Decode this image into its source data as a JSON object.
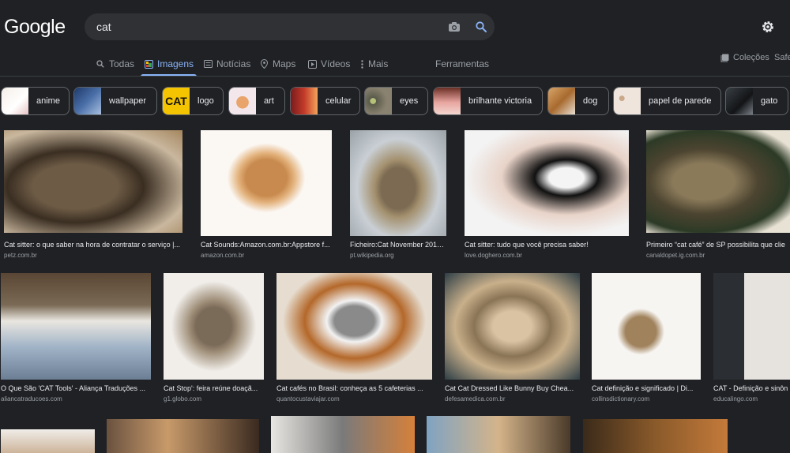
{
  "header": {
    "logo": "Google",
    "query": "cat"
  },
  "tabs": [
    {
      "label": "Todas"
    },
    {
      "label": "Imagens"
    },
    {
      "label": "Notícias"
    },
    {
      "label": "Maps"
    },
    {
      "label": "Vídeos"
    },
    {
      "label": "Mais"
    },
    {
      "label": "Ferramentas"
    },
    {
      "label": "Coleções"
    },
    {
      "label": "Safe"
    }
  ],
  "chips": [
    {
      "label": "anime"
    },
    {
      "label": "wallpaper"
    },
    {
      "label": "logo"
    },
    {
      "label": "art"
    },
    {
      "label": "celular"
    },
    {
      "label": "eyes"
    },
    {
      "label": "brilhante victoria"
    },
    {
      "label": "dog"
    },
    {
      "label": "papel de parede"
    },
    {
      "label": "gato"
    }
  ],
  "results": [
    {
      "caption": "Cat sitter: o que saber na hora de contratar o serviço |...",
      "source": "petz.com.br"
    },
    {
      "caption": "Cat Sounds:Amazon.com.br:Appstore f...",
      "source": "amazon.com.br"
    },
    {
      "caption": "Ficheiro:Cat November 2010...",
      "source": "pt.wikipedia.org"
    },
    {
      "caption": "Cat sitter: tudo que você precisa saber!",
      "source": "love.doghero.com.br"
    },
    {
      "caption": "Primeiro “cat café” de SP possibilita que clie",
      "source": "canaldopet.ig.com.br"
    },
    {
      "caption": "O Que São 'CAT Tools' - Aliança Traduções ...",
      "source": "aliancatraducoes.com"
    },
    {
      "caption": "Cat Stop': feira reúne doaçã...",
      "source": "g1.globo.com"
    },
    {
      "caption": "Cat cafés no Brasil: conheça as 5 cafeterias ...",
      "source": "quantocustaviajar.com"
    },
    {
      "caption": "Cat Cat Dressed Like Bunny Buy Chea...",
      "source": "defesamedica.com.br"
    },
    {
      "caption": "Cat definição e significado | Di...",
      "source": "collinsdictionary.com"
    },
    {
      "caption": "CAT - Definição e sinôn",
      "source": "educalingo.com"
    }
  ]
}
